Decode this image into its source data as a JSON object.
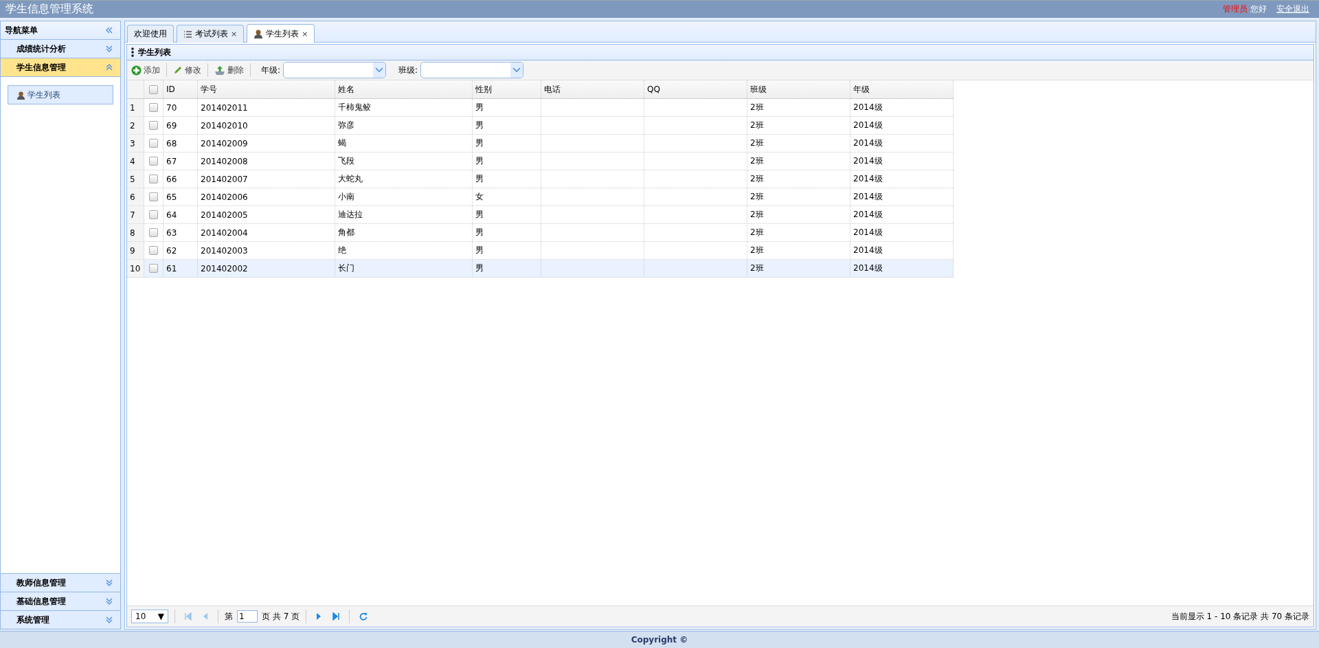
{
  "header": {
    "title": "学生信息管理系统",
    "user_role": "管理员",
    "greeting": "您好",
    "logout": "安全退出"
  },
  "sidebar": {
    "title": "导航菜单",
    "sections": [
      {
        "title": "成绩统计分析",
        "expanded": false
      },
      {
        "title": "学生信息管理",
        "expanded": true,
        "items": [
          {
            "label": "学生列表",
            "selected": true
          }
        ]
      }
    ],
    "bottom_sections": [
      {
        "title": "教师信息管理",
        "expanded": false
      },
      {
        "title": "基础信息管理",
        "expanded": false
      },
      {
        "title": "系统管理",
        "expanded": false
      }
    ]
  },
  "tabs": [
    {
      "label": "欢迎使用",
      "kind": "plain",
      "closable": false,
      "selected": false
    },
    {
      "label": "考试列表",
      "kind": "list",
      "closable": true,
      "selected": false
    },
    {
      "label": "学生列表",
      "kind": "person",
      "closable": true,
      "selected": true
    }
  ],
  "close_glyph": "×",
  "panel": {
    "title": "学生列表"
  },
  "toolbar": {
    "buttons": [
      {
        "label": "添加",
        "kind": "add"
      },
      {
        "label": "修改",
        "kind": "edit"
      },
      {
        "label": "删除",
        "kind": "delete"
      }
    ],
    "filters": [
      {
        "label": "年级:"
      },
      {
        "label": "班级:"
      }
    ]
  },
  "table": {
    "header_checked": false,
    "columns": [
      "ID",
      "学号",
      "姓名",
      "性别",
      "电话",
      "QQ",
      "班级",
      "年级"
    ],
    "rows": [
      {
        "n": "1",
        "checked": false,
        "selected": false,
        "cells": [
          "70",
          "201402011",
          "千柿鬼鲛",
          "男",
          "",
          "",
          "2班",
          "2014级"
        ]
      },
      {
        "n": "2",
        "checked": false,
        "selected": false,
        "cells": [
          "69",
          "201402010",
          "弥彦",
          "男",
          "",
          "",
          "2班",
          "2014级"
        ]
      },
      {
        "n": "3",
        "checked": false,
        "selected": false,
        "cells": [
          "68",
          "201402009",
          "蝎",
          "男",
          "",
          "",
          "2班",
          "2014级"
        ]
      },
      {
        "n": "4",
        "checked": false,
        "selected": false,
        "cells": [
          "67",
          "201402008",
          "飞段",
          "男",
          "",
          "",
          "2班",
          "2014级"
        ]
      },
      {
        "n": "5",
        "checked": false,
        "selected": false,
        "cells": [
          "66",
          "201402007",
          "大蛇丸",
          "男",
          "",
          "",
          "2班",
          "2014级"
        ]
      },
      {
        "n": "6",
        "checked": false,
        "selected": false,
        "cells": [
          "65",
          "201402006",
          "小南",
          "女",
          "",
          "",
          "2班",
          "2014级"
        ]
      },
      {
        "n": "7",
        "checked": false,
        "selected": false,
        "cells": [
          "64",
          "201402005",
          "迪达拉",
          "男",
          "",
          "",
          "2班",
          "2014级"
        ]
      },
      {
        "n": "8",
        "checked": false,
        "selected": false,
        "cells": [
          "63",
          "201402004",
          "角都",
          "男",
          "",
          "",
          "2班",
          "2014级"
        ]
      },
      {
        "n": "9",
        "checked": false,
        "selected": false,
        "cells": [
          "62",
          "201402003",
          "绝",
          "男",
          "",
          "",
          "2班",
          "2014级"
        ]
      },
      {
        "n": "10",
        "checked": false,
        "selected": true,
        "cells": [
          "61",
          "201402002",
          "长门",
          "男",
          "",
          "",
          "2班",
          "2014级"
        ]
      }
    ]
  },
  "pager": {
    "page_size": "10",
    "size_caret": "▼",
    "page_prefix": "第",
    "page": "1",
    "page_suffix": "页 共 7 页",
    "summary": "当前显示 1 - 10 条记录 共 70 条记录"
  },
  "footer": "Copyright ©"
}
